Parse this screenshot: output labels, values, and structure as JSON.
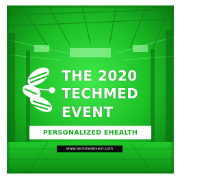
{
  "banner": {
    "title_line1": "THE 2020",
    "title_line2": "TECHMED",
    "title_line3": "EVENT",
    "tagline": "PERSONALIZED EHEALTH",
    "url": "www.techmedevent.com",
    "logo_icon": "techmed-leaf-logo-icon",
    "colors": {
      "green_primary": "#14b81e",
      "green_bright": "#39e645",
      "green_dark": "#0a6e10",
      "tagline_text": "#18a821",
      "url_pill_bg": "#0c0c0c",
      "text_white": "#ffffff"
    }
  }
}
